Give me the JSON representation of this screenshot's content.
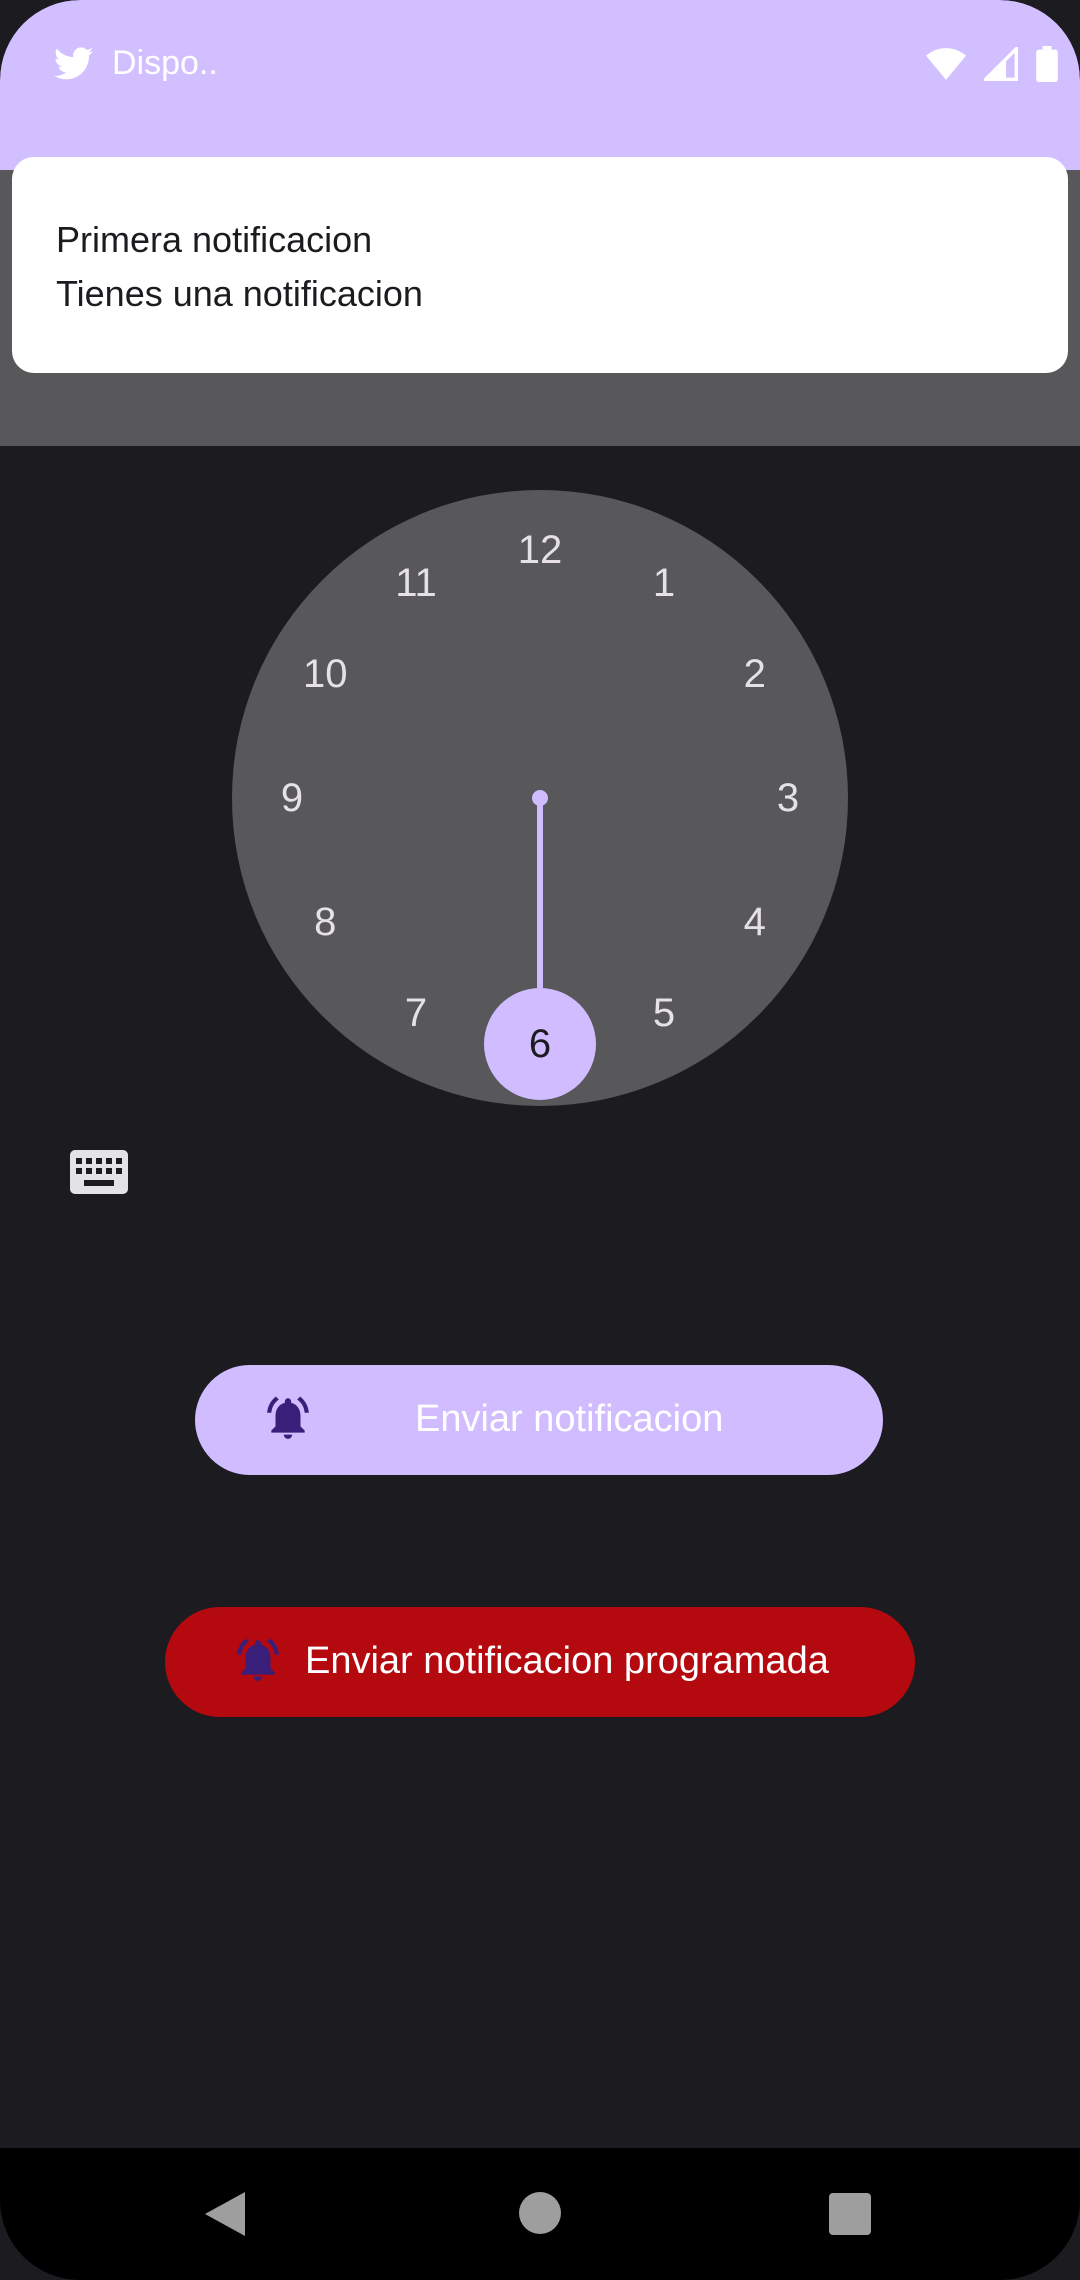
{
  "status_bar": {
    "app_icon": "twitter-bird-icon",
    "app_name": "Dispo..",
    "icons": [
      "wifi-icon",
      "cell-signal-icon",
      "battery-icon"
    ]
  },
  "notification": {
    "title": "Primera notificacion",
    "text": "Tienes una notificacion"
  },
  "clock": {
    "numbers": [
      "12",
      "1",
      "2",
      "3",
      "4",
      "5",
      "6",
      "7",
      "8",
      "9",
      "10",
      "11"
    ],
    "selected": "6"
  },
  "mode_toggle": {
    "icon": "keyboard-icon"
  },
  "buttons": {
    "send": {
      "icon": "alarm-bell-icon",
      "label": "Enviar notificacion"
    },
    "scheduled": {
      "icon": "alarm-bell-icon",
      "label": "Enviar notificacion programada"
    }
  },
  "colors": {
    "accent": "#d0bcff",
    "danger": "#b3090f",
    "background": "#1c1b20",
    "bell_dark": "#3a1f7a"
  },
  "nav": {
    "back_icon": "back-triangle-icon",
    "home_icon": "home-circle-icon",
    "recents_icon": "recents-square-icon"
  }
}
